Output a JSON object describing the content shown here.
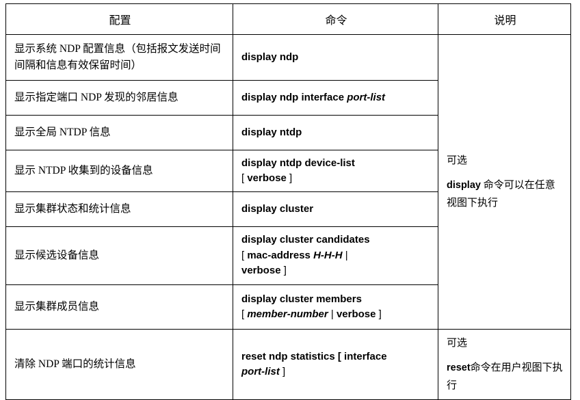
{
  "table": {
    "headers": {
      "config": "配置",
      "command": "命令",
      "description": "说明"
    },
    "rows": [
      {
        "config": "显示系统 NDP 配置信息（包括报文发送时间间隔和信息有效保留时间）",
        "command_plain": "display ndp",
        "command_parts": [
          {
            "text": "display ndp",
            "style": "bold"
          }
        ]
      },
      {
        "config": "显示指定端口 NDP 发现的邻居信息",
        "command_plain": "display ndp interface port-list",
        "command_parts": [
          {
            "text": "display ndp interface ",
            "style": "bold"
          },
          {
            "text": "port-list",
            "style": "italic"
          }
        ]
      },
      {
        "config": "显示全局 NTDP 信息",
        "command_plain": "display ntdp",
        "command_parts": [
          {
            "text": "display ntdp",
            "style": "bold"
          }
        ]
      },
      {
        "config": "显示 NTDP 收集到的设备信息",
        "command_plain": "display ntdp device-list [ verbose ]",
        "command_parts": [
          {
            "text": "display ntdp device-list",
            "style": "bold"
          },
          {
            "text": "\n",
            "style": "break"
          },
          {
            "text": "[ ",
            "style": "plain"
          },
          {
            "text": "verbose",
            "style": "bold"
          },
          {
            "text": " ]",
            "style": "plain"
          }
        ]
      },
      {
        "config": "显示集群状态和统计信息",
        "command_plain": "display cluster",
        "command_parts": [
          {
            "text": "display cluster",
            "style": "bold"
          }
        ]
      },
      {
        "config": "显示候选设备信息",
        "command_plain": "display cluster candidates [ mac-address H-H-H | verbose ]",
        "command_parts": [
          {
            "text": "display cluster candidates",
            "style": "bold"
          },
          {
            "text": "\n",
            "style": "break"
          },
          {
            "text": "[ ",
            "style": "plain"
          },
          {
            "text": "mac-address ",
            "style": "bold"
          },
          {
            "text": "H-H-H",
            "style": "italic"
          },
          {
            "text": " |",
            "style": "plain"
          },
          {
            "text": "\n",
            "style": "break"
          },
          {
            "text": "verbose",
            "style": "bold"
          },
          {
            "text": " ]",
            "style": "plain"
          }
        ]
      },
      {
        "config": "显示集群成员信息",
        "command_plain": "display cluster members [ member-number | verbose ]",
        "command_parts": [
          {
            "text": "display cluster members",
            "style": "bold"
          },
          {
            "text": "\n",
            "style": "break"
          },
          {
            "text": "[ ",
            "style": "plain"
          },
          {
            "text": "member-number",
            "style": "italic"
          },
          {
            "text": " | ",
            "style": "plain"
          },
          {
            "text": "verbose",
            "style": "bold"
          },
          {
            "text": " ]",
            "style": "plain"
          }
        ]
      },
      {
        "config": "清除 NDP 端口的统计信息",
        "command_plain": "reset ndp statistics [ interface port-list ]",
        "command_parts": [
          {
            "text": "reset ndp statistics [ interface",
            "style": "bold"
          },
          {
            "text": "\n",
            "style": "break"
          },
          {
            "text": "port-list",
            "style": "italic"
          },
          {
            "text": " ]",
            "style": "plain"
          }
        ]
      }
    ],
    "descriptions": [
      {
        "span_rows": 7,
        "optional_label": "可选",
        "keyword": "display",
        "body": " 命令可以在任意视图下执行"
      },
      {
        "span_rows": 1,
        "optional_label": "可选",
        "keyword": "reset",
        "body": "命令在用户视图下执行"
      }
    ]
  },
  "colors": {
    "header_fill": "#d8d8d8",
    "border": "#000000",
    "text": "#000000",
    "background": "#ffffff"
  }
}
